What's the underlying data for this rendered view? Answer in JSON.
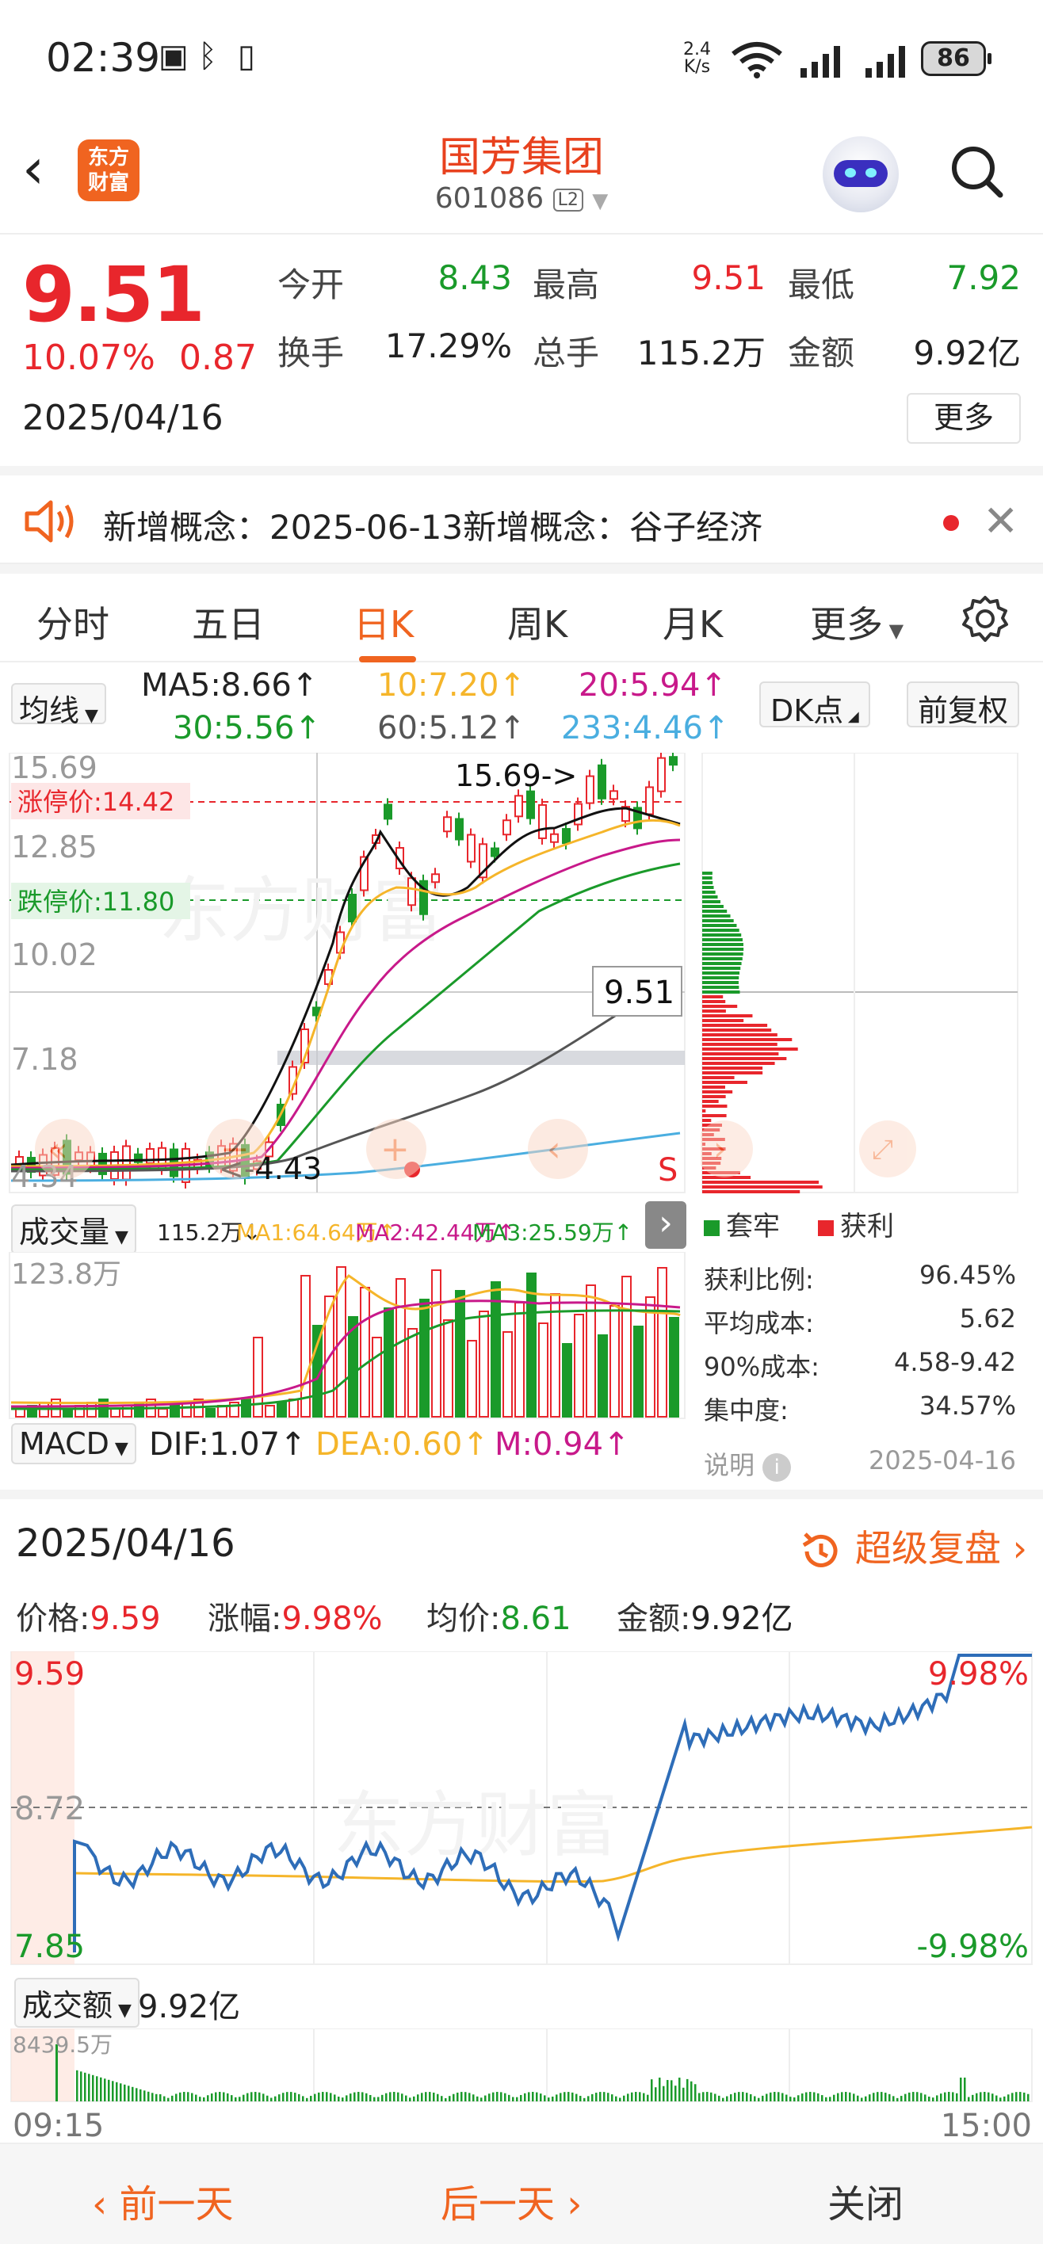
{
  "status_bar": {
    "time": "02:39",
    "net_speed_top": "2.4",
    "net_speed_bottom": "K/s",
    "battery": "86"
  },
  "header": {
    "back_icon": "chevron-left-icon",
    "logo_line1": "东方",
    "logo_line2": "财富",
    "stock_name": "国芳集团",
    "stock_code": "601086",
    "level_badge": "L2"
  },
  "quote": {
    "price": "9.51",
    "change_pct": "10.07%",
    "change_amt": "0.87",
    "date": "2025/04/16",
    "open_label": "今开",
    "open": "8.43",
    "high_label": "最高",
    "high": "9.51",
    "low_label": "最低",
    "low": "7.92",
    "turnover_label": "换手",
    "turnover": "17.29%",
    "volume_label": "总手",
    "volume": "115.2万",
    "amount_label": "金额",
    "amount": "9.92亿",
    "more_label": "更多"
  },
  "concept": {
    "text": "新增概念：2025-06-13新增概念：谷子经济"
  },
  "tabs": [
    "分时",
    "五日",
    "日K",
    "周K",
    "月K",
    "更多"
  ],
  "active_tab": "日K",
  "ma_row": {
    "selector": "均线",
    "ma5": "MA5:8.66↑",
    "ma10": "10:7.20↑",
    "ma20": "20:5.94↑",
    "ma30": "30:5.56↑",
    "ma60": "60:5.12↑",
    "ma233": "233:4.46↑",
    "dk_button": "DK点",
    "adjust_button": "前复权"
  },
  "kline": {
    "y_labels": [
      "15.69",
      "12.85",
      "10.02",
      "7.18",
      "4.34"
    ],
    "limit_up": "涨停价:14.42",
    "limit_down": "跌停价:11.80",
    "max_marker": "15.69->",
    "last_price_tag": "9.51",
    "min_marker": "<-4.43",
    "s_marker": "S"
  },
  "volume_row": {
    "selector": "成交量",
    "vol": "115.2万↓",
    "ma1": "MA1:64.64万↑",
    "ma2": "MA2:42.44万↑",
    "ma3": "MA3:25.59万↑",
    "axis_max": "123.8万"
  },
  "macd_row": {
    "selector": "MACD",
    "dif": "DIF:1.07↑",
    "dea": "DEA:0.60↑",
    "m": "M:0.94↑"
  },
  "chips": {
    "legend_trapped": "套牢",
    "legend_profit": "获利",
    "rows": [
      {
        "label": "获利比例:",
        "value": "96.45%"
      },
      {
        "label": "平均成本:",
        "value": "5.62"
      },
      {
        "label": "90%成本:",
        "value": "4.58-9.42"
      },
      {
        "label": "集中度:",
        "value": "34.57%"
      }
    ],
    "note_label": "说明",
    "note_date": "2025-04-16"
  },
  "detail": {
    "date": "2025/04/16",
    "replay": "超级复盘",
    "price_label": "价格:",
    "price": "9.59",
    "pct_label": "涨幅:",
    "pct": "9.98%",
    "avg_label": "均价:",
    "avg": "8.61",
    "amt_label": "金额:",
    "amt": "9.92亿",
    "y_top": "9.59",
    "y_mid": "8.72",
    "y_bot": "7.85",
    "pct_top": "9.98%",
    "pct_bot": "-9.98%",
    "amount_selector": "成交额",
    "amount_value": "9.92亿",
    "vol_axis": "8439.5万",
    "time_start": "09:15",
    "time_end": "15:00"
  },
  "footer": {
    "prev": "前一天",
    "next": "后一天",
    "close": "关闭"
  },
  "colors": {
    "accent": "#f06420",
    "up": "#e8262c",
    "down": "#1a9a2a"
  }
}
